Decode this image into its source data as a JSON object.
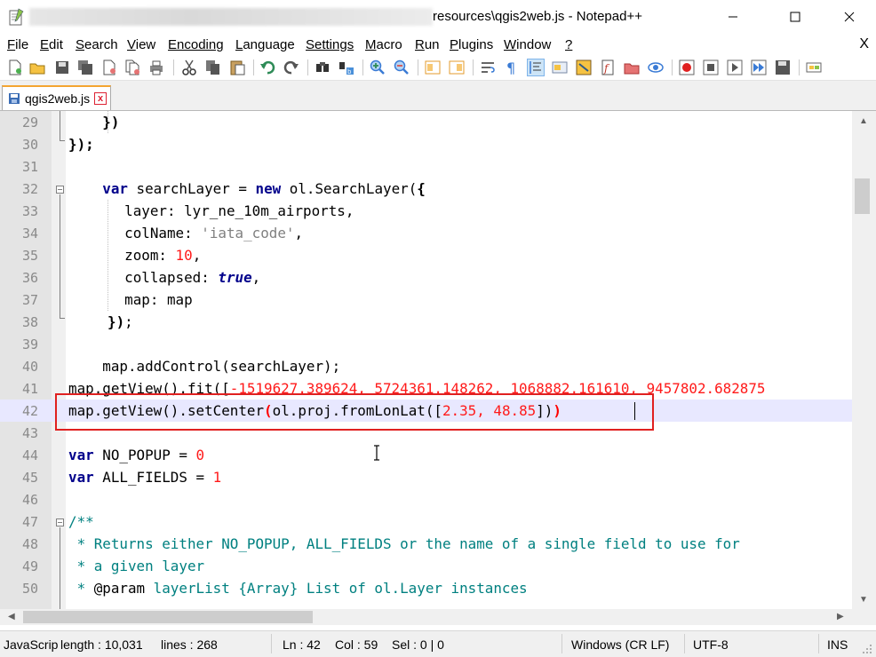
{
  "window": {
    "title_visible": "resources\\qgis2web.js - Notepad++"
  },
  "menu": {
    "items": [
      {
        "accel": "F",
        "rest": "ile"
      },
      {
        "accel": "E",
        "rest": "dit"
      },
      {
        "accel": "S",
        "rest": "earch"
      },
      {
        "accel": "V",
        "rest": "iew"
      },
      {
        "accel": "",
        "rest": "Encoding"
      },
      {
        "accel": "L",
        "rest": "anguage"
      },
      {
        "accel": "",
        "rest": "Settings"
      },
      {
        "accel": "M",
        "rest": "acro"
      },
      {
        "accel": "R",
        "rest": "un"
      },
      {
        "accel": "P",
        "rest": "lugins"
      },
      {
        "accel": "W",
        "rest": "indow"
      },
      {
        "accel": "?",
        "rest": ""
      }
    ],
    "close": "X"
  },
  "tab": {
    "label": "qgis2web.js",
    "close": "x"
  },
  "editor": {
    "current_line": "42",
    "lines": [
      {
        "n": "29"
      },
      {
        "n": "30"
      },
      {
        "n": "31"
      },
      {
        "n": "32"
      },
      {
        "n": "33"
      },
      {
        "n": "34"
      },
      {
        "n": "35"
      },
      {
        "n": "36"
      },
      {
        "n": "37"
      },
      {
        "n": "38"
      },
      {
        "n": "39"
      },
      {
        "n": "40"
      },
      {
        "n": "41"
      },
      {
        "n": "42"
      },
      {
        "n": "43"
      },
      {
        "n": "44"
      },
      {
        "n": "45"
      },
      {
        "n": "46"
      },
      {
        "n": "47"
      },
      {
        "n": "48"
      },
      {
        "n": "49"
      },
      {
        "n": "50"
      }
    ],
    "tokens": {
      "l29": "    })",
      "l30": "});",
      "l32_kw": "var",
      "l32_a": " searchLayer = ",
      "l32_kw2": "new",
      "l32_b": " ol.SearchLayer(",
      "l32_c": "{",
      "l33": "  layer: lyr_ne_10m_airports,",
      "l34_a": "  colName: ",
      "l34_s": "'iata_code'",
      "l34_b": ",",
      "l35_a": "  zoom: ",
      "l35_n": "10",
      "l35_b": ",",
      "l36_a": "  collapsed: ",
      "l36_k": "true",
      "l36_b": ",",
      "l37": "  map: map",
      "l38_a": "})",
      "l38_b": ";",
      "l40": "    map.addControl(searchLayer);",
      "l41_a": "map.getView().fit([",
      "l41_n": "-1519627.389624, 5724361.148262, 1068882.161610, 9457802.682875",
      "l42_a": "map.getView().setCenter",
      "l42_p1": "(",
      "l42_b": "ol.proj.fromLonLat([",
      "l42_n": "2.35, 48.85",
      "l42_c": "])",
      "l42_p2": ")",
      "l44_kw": "var",
      "l44_a": " NO_POPUP = ",
      "l44_n": "0",
      "l45_kw": "var",
      "l45_a": " ALL_FIELDS = ",
      "l45_n": "1",
      "l47": "/**",
      "l48": " * Returns either NO_POPUP, ALL_FIELDS or the name of a single field to use for",
      "l49": " * a given layer",
      "l50_a": " * ",
      "l50_p": "@param",
      "l50_b": " layerList {Array} List of ol.Layer instances"
    }
  },
  "status": {
    "type": "JavaScrip",
    "length": "length : 10,031",
    "lines": "lines : 268",
    "ln": "Ln : 42",
    "col": "Col : 59",
    "sel": "Sel : 0 | 0",
    "eol": "Windows (CR LF)",
    "encoding": "UTF-8",
    "mode": "INS"
  }
}
